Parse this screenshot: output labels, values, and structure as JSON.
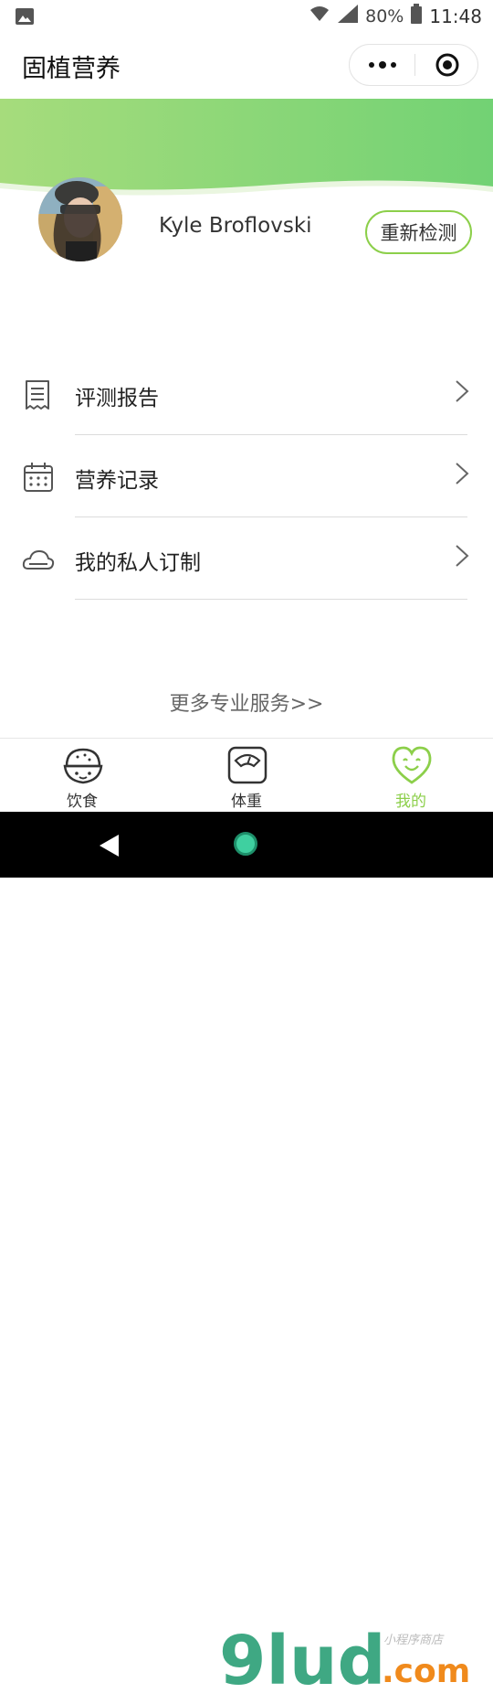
{
  "status": {
    "battery": "80%",
    "time": "11:48"
  },
  "nav": {
    "title": "固植营养"
  },
  "profile": {
    "username": "Kyle Broflovski",
    "retest_label": "重新检测"
  },
  "menu": [
    {
      "label": "评测报告",
      "icon": "report-icon"
    },
    {
      "label": "营养记录",
      "icon": "calendar-icon"
    },
    {
      "label": "我的私人订制",
      "icon": "cloud-icon"
    }
  ],
  "more_services": "更多专业服务>>",
  "tabs": [
    {
      "label": "饮食",
      "icon": "food-icon",
      "active": false
    },
    {
      "label": "体重",
      "icon": "scale-icon",
      "active": false
    },
    {
      "label": "我的",
      "icon": "heart-face-icon",
      "active": true
    }
  ],
  "watermark": {
    "logo": "9lud",
    "tld": ".com",
    "tagline": "小程序商店"
  },
  "colors": {
    "accent": "#8ccf4a",
    "banner_start": "#a6dc7c",
    "banner_end": "#72d274"
  }
}
